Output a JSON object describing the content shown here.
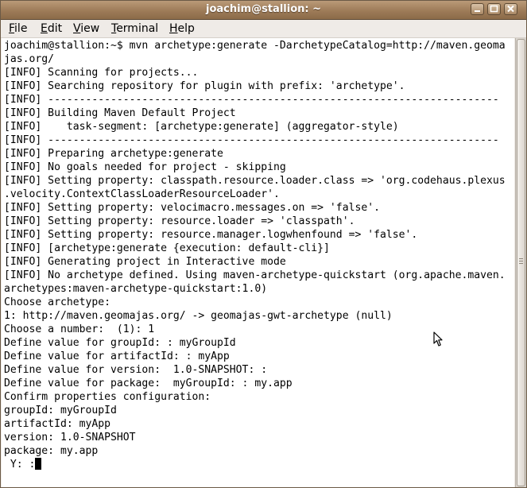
{
  "window": {
    "title": "joachim@stallion: ~",
    "buttons": {
      "minimize_icon": "minimize-icon",
      "maximize_icon": "maximize-icon",
      "close_icon": "close-icon"
    },
    "colors": {
      "titlebar": "#9d7b58",
      "title_text": "#ffffff",
      "menubar": "#efebe7",
      "terminal_bg": "#ffffff",
      "terminal_fg": "#000000"
    }
  },
  "menu": [
    {
      "label_prefix": "",
      "mnemonic": "F",
      "label_rest": "ile"
    },
    {
      "label_prefix": "",
      "mnemonic": "E",
      "label_rest": "dit"
    },
    {
      "label_prefix": "",
      "mnemonic": "V",
      "label_rest": "iew"
    },
    {
      "label_prefix": "",
      "mnemonic": "T",
      "label_rest": "erminal"
    },
    {
      "label_prefix": "",
      "mnemonic": "H",
      "label_rest": "elp"
    }
  ],
  "terminal": {
    "lines": [
      "joachim@stallion:~$ mvn archetype:generate -DarchetypeCatalog=http://maven.geoma",
      "jas.org/",
      "[INFO] Scanning for projects...",
      "[INFO] Searching repository for plugin with prefix: 'archetype'.",
      "[INFO] ------------------------------------------------------------------------",
      "[INFO] Building Maven Default Project",
      "[INFO]    task-segment: [archetype:generate] (aggregator-style)",
      "[INFO] ------------------------------------------------------------------------",
      "[INFO] Preparing archetype:generate",
      "[INFO] No goals needed for project - skipping",
      "[INFO] Setting property: classpath.resource.loader.class => 'org.codehaus.plexus",
      ".velocity.ContextClassLoaderResourceLoader'.",
      "[INFO] Setting property: velocimacro.messages.on => 'false'.",
      "[INFO] Setting property: resource.loader => 'classpath'.",
      "[INFO] Setting property: resource.manager.logwhenfound => 'false'.",
      "[INFO] [archetype:generate {execution: default-cli}]",
      "[INFO] Generating project in Interactive mode",
      "[INFO] No archetype defined. Using maven-archetype-quickstart (org.apache.maven.",
      "archetypes:maven-archetype-quickstart:1.0)",
      "Choose archetype:",
      "1: http://maven.geomajas.org/ -> geomajas-gwt-archetype (null)",
      "Choose a number:  (1): 1",
      "Define value for groupId: : myGroupId",
      "Define value for artifactId: : myApp",
      "Define value for version:  1.0-SNAPSHOT: :",
      "Define value for package:  myGroupId: : my.app",
      "Confirm properties configuration:",
      "groupId: myGroupId",
      "artifactId: myApp",
      "version: 1.0-SNAPSHOT",
      "package: my.app",
      " Y: :"
    ]
  },
  "scrollbar": {
    "position_fraction": 1.0
  }
}
